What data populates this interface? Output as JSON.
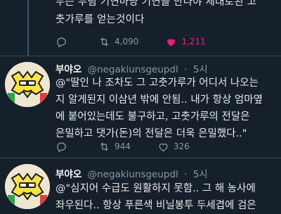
{
  "colors": {
    "background": "#15202b",
    "text": "#e7e9ea",
    "secondary": "#8b98a5",
    "like_active": "#f91880",
    "divider": "#38444d"
  },
  "previous_tweet": {
    "lines": [
      "무슨 무림 기연마냥 기연을 만나야 제대로된 고",
      "춧가루를 얻는것이다"
    ],
    "actions": {
      "replies": "",
      "retweets": "4,090",
      "likes": "1,211",
      "liked": true
    }
  },
  "tweets": [
    {
      "display_name": "부야오",
      "handle": "@negakiunsgeupdl",
      "separator": "·",
      "time": "5시",
      "lines": [
        "@\"딸인 나 조차도 그 고춧가루가 어디서 나오는",
        "지 알게된지 이삼년 밖에 안됨.. 내가 항상 엄마옆",
        "에 붙어있는데도 불구하고, 고춧가루의 전달은",
        "은밀하고 댓가(돈)의 전달은 더욱 은밀했다..\""
      ],
      "actions": {
        "replies": "",
        "retweets": "944",
        "likes": "326",
        "liked": false
      }
    },
    {
      "display_name": "부야오",
      "handle": "@negakiunsgeupdl",
      "separator": "·",
      "time": "5시",
      "lines": [
        "@\"심지어 수급도 원활하지 못함.. 그 해 농사에",
        "좌우된다.. 항상 푸른색 비닐봉투 두세겹에 검은"
      ]
    }
  ]
}
